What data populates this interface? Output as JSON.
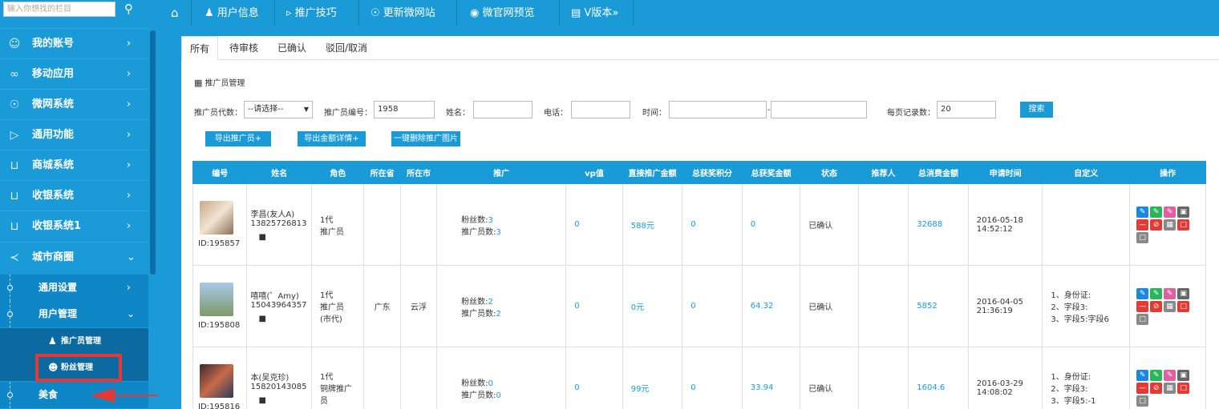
{
  "sidebar": {
    "search_placeholder": "输入你想找的栏目",
    "menus": [
      {
        "label": "我的账号",
        "icon": "user-icon"
      },
      {
        "label": "移动应用",
        "icon": "apps-icon"
      },
      {
        "label": "微网系统",
        "icon": "globe-icon"
      },
      {
        "label": "通用功能",
        "icon": "play-circle-icon"
      },
      {
        "label": "商城系统",
        "icon": "cart-icon"
      },
      {
        "label": "收银系统",
        "icon": "cart-icon"
      },
      {
        "label": "收银系统1",
        "icon": "cart-icon"
      },
      {
        "label": "城市商圈",
        "icon": "share-icon"
      }
    ],
    "submenus": [
      {
        "label": "通用设置"
      },
      {
        "label": "用户管理"
      }
    ],
    "sub2": [
      {
        "label": "推广员管理"
      },
      {
        "label": "粉丝管理"
      }
    ],
    "food": "美食"
  },
  "topbar": {
    "items": [
      {
        "label": "用户信息"
      },
      {
        "label": "推广技巧"
      },
      {
        "label": "更新微网站"
      },
      {
        "label": "微官网预览"
      },
      {
        "label": "V版本"
      }
    ]
  },
  "tabs": [
    "所有",
    "待审核",
    "已确认",
    "驳回/取消"
  ],
  "page_title": "推广员管理",
  "filters": {
    "level_label": "推广员代数：",
    "level_value": "--请选择--",
    "no_label": "推广员编号：",
    "no_value": "1958",
    "name_label": "姓名：",
    "phone_label": "电话：",
    "time_label": "时间：",
    "time_sep": "-",
    "per_page_label": "每页记录数：",
    "per_page_value": "20",
    "search_btn": "搜索"
  },
  "actions": [
    "导出推广员+",
    "导出金额详情+",
    "一键删除推广图片"
  ],
  "table": {
    "headers": [
      "编号",
      "姓名",
      "角色",
      "所在省",
      "所在市",
      "推广",
      "vp值",
      "直接推广金额",
      "总获奖积分",
      "总获奖金额",
      "状态",
      "推荐人",
      "总消费金额",
      "申请时间",
      "自定义",
      "操作"
    ],
    "rows": [
      {
        "id": "ID:195857",
        "name": "李昌(友人A)",
        "phone": "13825726813",
        "role1": "1代",
        "role2": "推广员",
        "role3": "",
        "province": "",
        "city": "",
        "fans_label": "粉丝数:",
        "fans": "3",
        "promo_label": "推广员数:",
        "promo": "3",
        "vp": "0",
        "direct": "588元",
        "points": "0",
        "bonus": "0",
        "status": "已确认",
        "ref": "",
        "consume": "32688",
        "date": "2016-05-18",
        "time": "14:52:12",
        "custom": []
      },
      {
        "id": "ID:195808",
        "name": "嘻嘻(゜Amy)",
        "phone": "15043964357",
        "role1": "1代",
        "role2": "推广员",
        "role3": "(市代)",
        "province": "广东",
        "city": "云浮",
        "fans_label": "粉丝数:",
        "fans": "2",
        "promo_label": "推广员数:",
        "promo": "2",
        "vp": "0",
        "direct": "0元",
        "points": "0",
        "bonus": "64.32",
        "status": "已确认",
        "ref": "",
        "consume": "5852",
        "date": "2016-04-05",
        "time": "21:36:19",
        "custom": [
          "1、身份证:",
          "2、字段3:",
          "3、字段5:字段6"
        ]
      },
      {
        "id": "ID:195816",
        "name": "本(吴克珍)",
        "phone": "15820143085",
        "role1": "1代",
        "role2": "铜牌推广",
        "role3": "员",
        "province": "",
        "city": "",
        "fans_label": "粉丝数:",
        "fans": "0",
        "promo_label": "推广员数:",
        "promo": "0",
        "vp": "0",
        "direct": "99元",
        "points": "0",
        "bonus": "33.94",
        "status": "已确认",
        "ref": "",
        "consume": "1604.6",
        "date": "2016-03-29",
        "time": "14:08:02",
        "custom": [
          "1、身份证:",
          "2、字段3:",
          "3、字段5:-1"
        ]
      }
    ]
  },
  "colors": {
    "primary": "#1b9ad8",
    "highlight": "#e53935"
  }
}
